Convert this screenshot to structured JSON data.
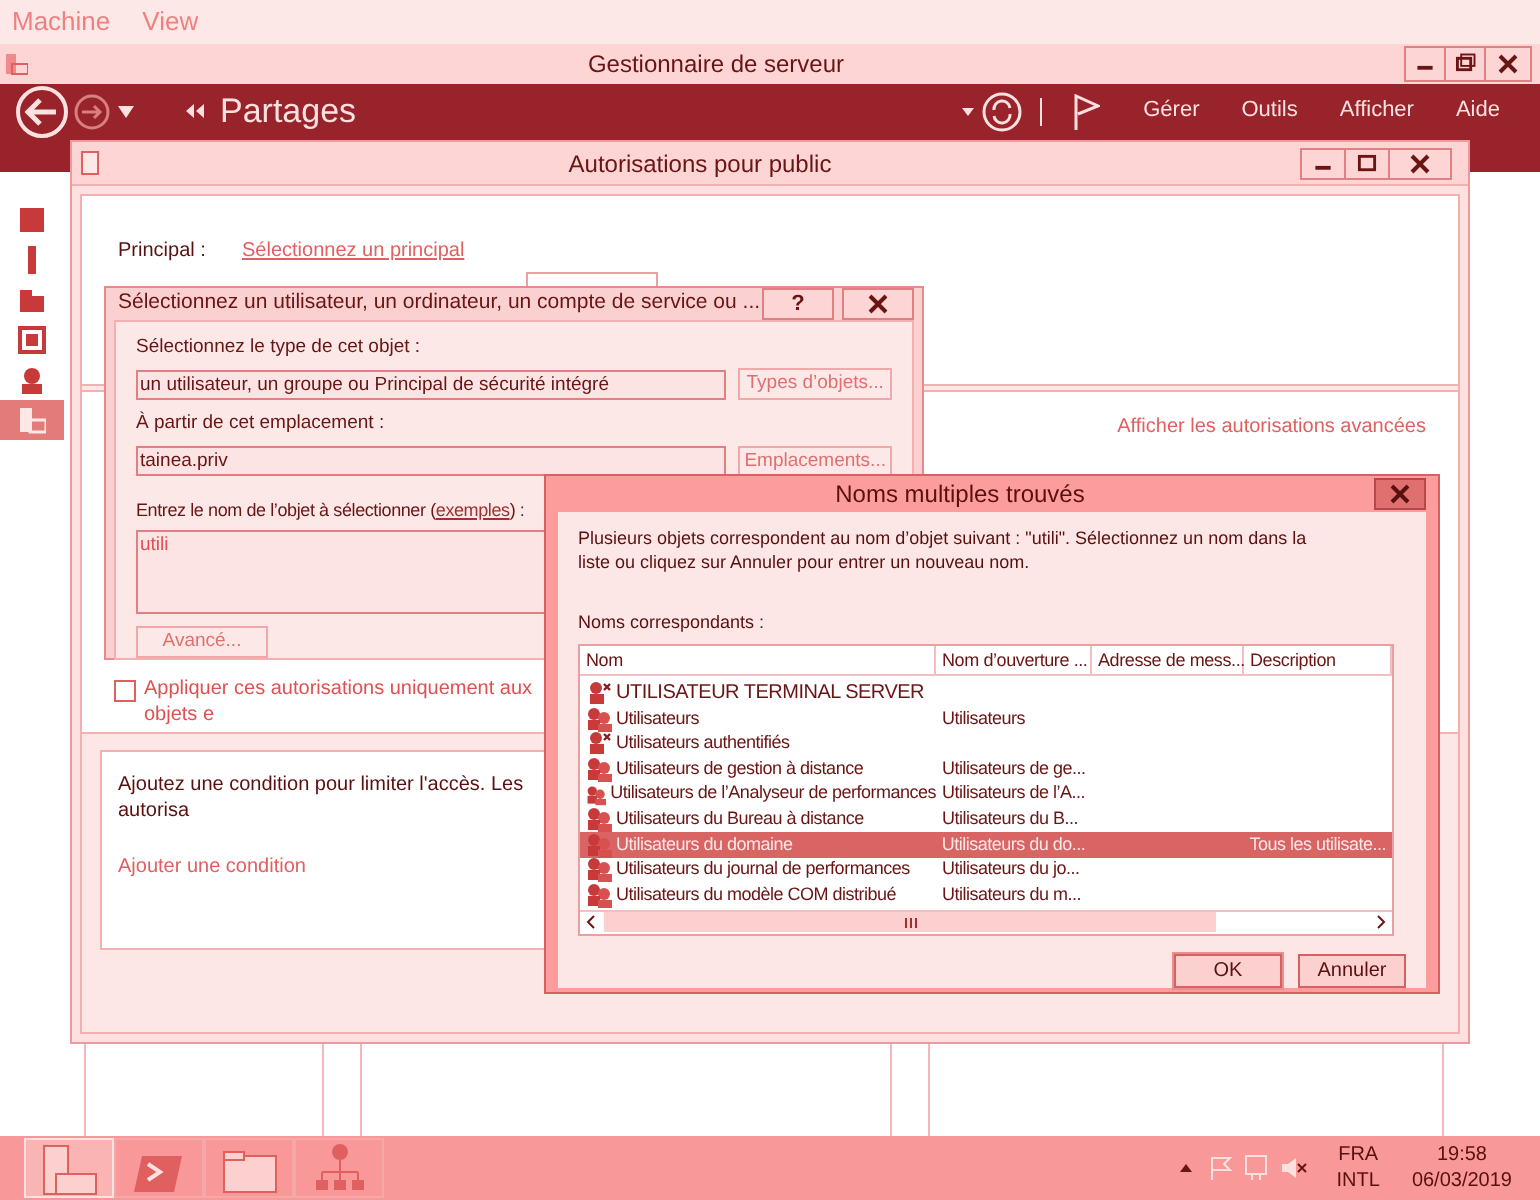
{
  "vm_menu": [
    "Machine",
    "View"
  ],
  "window": {
    "title": "Gestionnaire de serveur"
  },
  "toolbar": {
    "breadcrumb": "Partages",
    "menus": [
      "Gérer",
      "Outils",
      "Afficher",
      "Aide"
    ]
  },
  "sidebar": {
    "items": [
      {
        "selected": false
      },
      {
        "selected": false
      },
      {
        "selected": false
      },
      {
        "selected": false
      },
      {
        "selected": false
      },
      {
        "selected": true
      }
    ]
  },
  "permissions_dialog": {
    "title": "Autorisations pour public",
    "principal_label": "Principal :",
    "principal_link": "Sélectionnez un principal",
    "advanced_link": "Afficher les autorisations avancées",
    "apply_checkbox": {
      "label": "Appliquer ces autorisations uniquement aux objets e",
      "checked": false
    },
    "condition_text": "Ajoutez une condition pour limiter l'accès. Les autorisa",
    "condition_link": "Ajouter une condition"
  },
  "select_dialog": {
    "title": "Sélectionnez un utilisateur, un ordinateur, un compte de service ou ...",
    "help_button": "?",
    "object_type_label": "Sélectionnez le type de cet objet :",
    "object_type_value": "un utilisateur, un groupe ou Principal de sécurité intégré",
    "object_types_button": "Types d’objets...",
    "location_label": "À partir de cet emplacement :",
    "location_value": "tainea.priv",
    "locations_button": "Emplacements...",
    "enter_label": {
      "before": "Entrez le nom de l’objet à sélectionner (",
      "link": "exemples",
      "after": ") :"
    },
    "enter_value": "utili",
    "advanced_button": "Avancé..."
  },
  "names_dialog": {
    "title": "Noms multiples trouvés",
    "message": "Plusieurs objets correspondent au nom d’objet suivant : \"utili\". Sélectionnez un nom dans la liste ou cliquez sur Annuler pour entrer un nouveau nom.",
    "list_label": "Noms correspondants :",
    "columns": [
      "Nom",
      "Nom d’ouverture ...",
      "Adresse de mess...",
      "Description"
    ],
    "rows": [
      {
        "kind": "builtin",
        "name": "UTILISATEUR TERMINAL SERVER",
        "selected": false
      },
      {
        "kind": "group",
        "name": "Utilisateurs",
        "logon": "Utilisateurs",
        "selected": false
      },
      {
        "kind": "builtin",
        "name": "Utilisateurs authentifiés",
        "selected": false
      },
      {
        "kind": "group",
        "name": "Utilisateurs de gestion à distance",
        "logon": "Utilisateurs de ge...",
        "selected": false
      },
      {
        "kind": "group",
        "name": "Utilisateurs de l’Analyseur de performances",
        "logon": "Utilisateurs de l’A...",
        "selected": false
      },
      {
        "kind": "group",
        "name": "Utilisateurs du Bureau à distance",
        "logon": "Utilisateurs du B...",
        "selected": false
      },
      {
        "kind": "group",
        "name": "Utilisateurs du domaine",
        "logon": "Utilisateurs du do...",
        "description": "Tous les utilisate...",
        "selected": true
      },
      {
        "kind": "group",
        "name": "Utilisateurs du journal de performances",
        "logon": "Utilisateurs du jo...",
        "selected": false
      },
      {
        "kind": "group",
        "name": "Utilisateurs du modèle COM distribué",
        "logon": "Utilisateurs du m...",
        "selected": false
      }
    ],
    "buttons": [
      "OK",
      "Annuler"
    ]
  },
  "taskbar": {
    "apps": [
      {
        "selected": true
      },
      {
        "selected": false
      },
      {
        "selected": false
      },
      {
        "selected": false
      }
    ]
  },
  "tray": {
    "language": "FRA",
    "layout": "INTL",
    "time": "19:58",
    "date": "06/03/2019"
  }
}
